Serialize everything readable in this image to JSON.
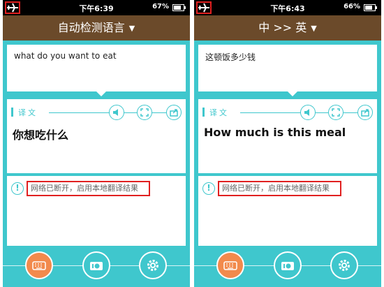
{
  "screens": [
    {
      "status": {
        "time": "下午6:39",
        "battery": "67%"
      },
      "header": {
        "title": "自动检测语言"
      },
      "input_text": "what do you want to eat",
      "result": {
        "label": "译文",
        "text": "你想吃什么"
      },
      "notice": {
        "text": "网络已断开，启用本地翻译结果"
      }
    },
    {
      "status": {
        "time": "下午6:43",
        "battery": "66%"
      },
      "header": {
        "title": "中 >> 英"
      },
      "input_text": "这顿饭多少钱",
      "result": {
        "label": "译文",
        "text": "How much is this meal"
      },
      "notice": {
        "text": "网络已断开，启用本地翻译结果"
      }
    }
  ],
  "icons": {
    "status": [
      "airplane-icon",
      "battery-icon"
    ],
    "result_controls": [
      "speaker-icon",
      "fullscreen-icon",
      "share-icon"
    ],
    "toolbar": [
      "keyboard-icon",
      "camera-icon",
      "settings-icon"
    ],
    "notice": "exclamation-icon",
    "header": "caret-down-icon"
  },
  "colors": {
    "accent": "#3fc7cd",
    "header_bg": "#6b4a2a",
    "keyboard_active": "#f28a4c",
    "annotation_box": "#e02020"
  }
}
